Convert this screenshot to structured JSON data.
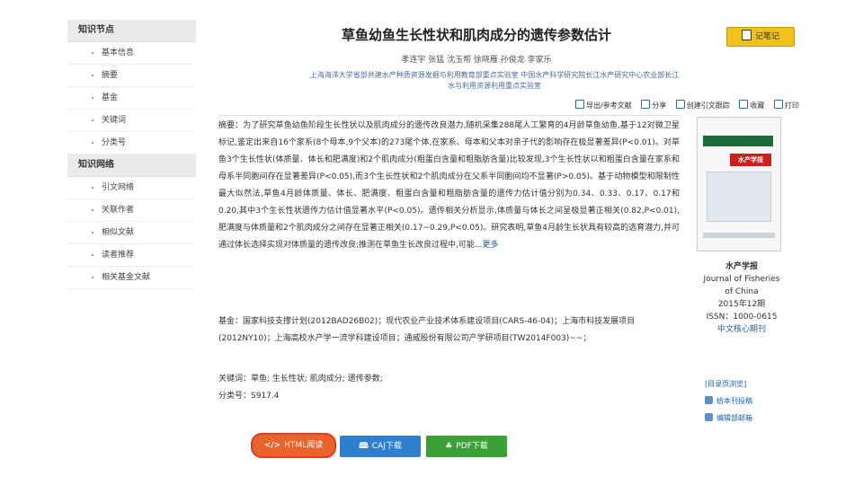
{
  "sidebar": {
    "sections": [
      {
        "title": "知识节点",
        "items": [
          "基本信息",
          "摘要",
          "基金",
          "关键词",
          "分类号"
        ]
      },
      {
        "title": "知识网络",
        "items": [
          "引文网络",
          "关联作者",
          "相似文献",
          "读者推荐",
          "相关基金文献"
        ]
      }
    ]
  },
  "article": {
    "title": "草鱼幼鱼生长性状和肌肉成分的遗传参数估计",
    "authors": "孝连宇   张猛   沈玉帮   徐晓雁   孙俊龙   李家乐",
    "affiliation_line1": "上海海洋大学省部共建水产种质资源发掘与利用教育部重点实验室   中国水产科学研究院长江水产研究中心农业部长江",
    "affiliation_line2": "水与利用资源利用重点实验室"
  },
  "note_button": "记笔记",
  "tools": [
    "导出/参考文献",
    "分享",
    "创建引文跟踪",
    "收藏",
    "打印"
  ],
  "abstract": {
    "label": "摘要：",
    "text": "为了研究草鱼幼鱼阶段生长性状以及肌肉成分的遗传改良潜力,随机采集288尾人工繁育的4月龄草鱼幼鱼,基于12对微卫星标记,鉴定出来自16个家系(8个母本,9个父本)的273尾个体,在家系、母本和父本对亲子代的影响存在极显著差异(P<0.01)。对草鱼3个生长性状(体质量、体长和肥满度)和2个肌肉成分(粗蛋白含量和粗脂肪含量)比较发现,3个生长性状以和粗蛋白含量在家系和母系半同胞间存在显著差异(P<0.05),而3个生长性状和2个肌肉成分在父系半同胞间均不显著(P>0.05)。基于动物模型和限制性最大似然法,草鱼4月龄体质量、体长、肥满度、粗蛋白含量和粗脂肪含量的遗传力估计值分别为0.34、0.33、0.17、0.17和0.20,其中3个生长性状遗传力估计值显著水平(P<0.05)。遗传相关分析显示,体质量与体长之间呈极显著正相关(0.82,P<0.01),肥满度与体质量和2个肌肉成分之间存在显著正相关(0.17~0.29,P<0.05)。研究表明,草鱼4月龄生长状具有较高的选育潜力,并可通过体长选择实现对体质量的遗传改良;推测在草鱼生长改良过程中,可能...",
    "more": "更多"
  },
  "fund": {
    "label": "基金：",
    "text": "国家科技支撑计划(2012BAD26B02)；现代农业产业技术体系建设项目(CARS-46-04)；上海市科技发展项目(2012NY10)；上海高校水产学一流学科建设项目；通威股份有限公司产学研项目(TW2014F003)~~；"
  },
  "keywords": {
    "label": "关键词：",
    "text": "草鱼; 生长性状; 肌肉成分; 遗传参数;"
  },
  "classification": {
    "label": "分类号：",
    "text": "S917.4"
  },
  "cover": {
    "journal_logo_text": "水产学报"
  },
  "journal": {
    "name": "水产学报",
    "en_line1": "Journal of Fisheries",
    "en_line2": "of China",
    "issue": "2015年12期",
    "issn": "ISSN：1000-0615",
    "core": "中文核心期刊"
  },
  "side_links": [
    "[目录页浏览]",
    "给本刊投稿",
    "编辑部邮箱"
  ],
  "buttons": {
    "html": "HTML阅读",
    "caj": "CAJ下载",
    "pdf": "PDF下载"
  },
  "colors": {
    "note_button": "#f2c21a",
    "html_button": "#e8642c",
    "caj_button": "#2f7fd0",
    "pdf_button": "#3ba135",
    "link": "#1a5ea8"
  }
}
